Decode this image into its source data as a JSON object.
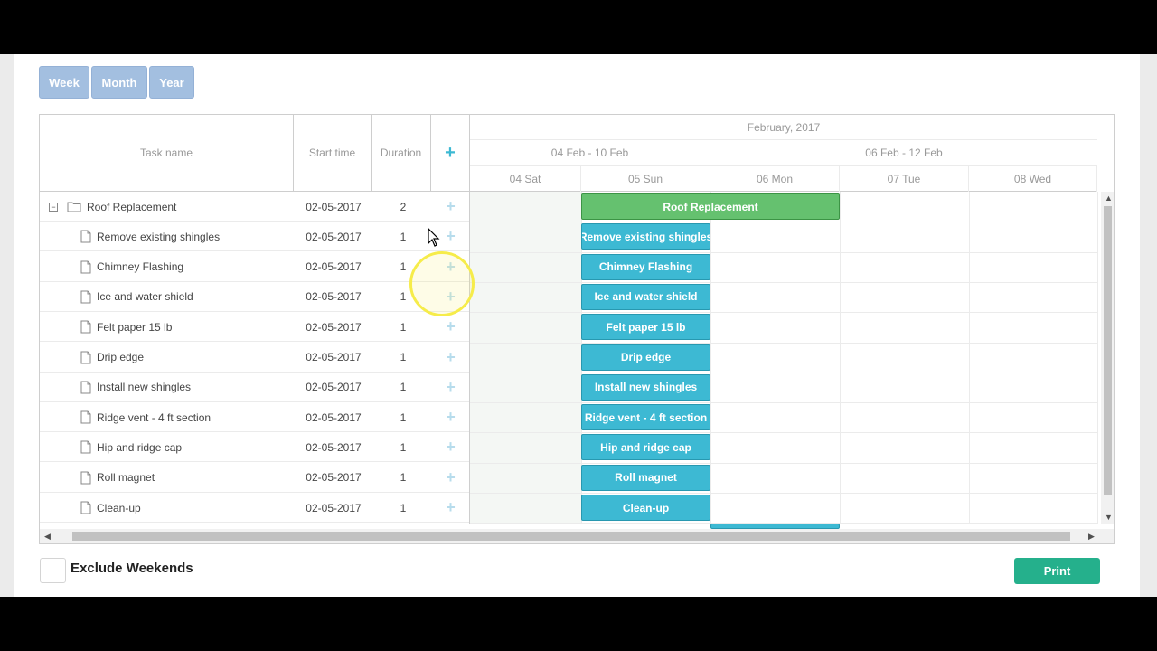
{
  "scale": {
    "week": "Week",
    "month": "Month",
    "year": "Year"
  },
  "grid_header": {
    "task_name": "Task name",
    "start_time": "Start time",
    "duration": "Duration",
    "add": "+"
  },
  "timeline": {
    "month": "February, 2017",
    "weeks": [
      "04 Feb - 10 Feb",
      "06 Feb - 12 Feb"
    ],
    "days": [
      "04 Sat",
      "05 Sun",
      "06 Mon",
      "07 Tue",
      "08 Wed"
    ]
  },
  "tasks": [
    {
      "name": "Roof Replacement",
      "start": "02-05-2017",
      "duration": "2",
      "type": "project",
      "add": "+",
      "toggle": "−"
    },
    {
      "name": "Remove existing shingles",
      "start": "02-05-2017",
      "duration": "1",
      "type": "task",
      "add": "+"
    },
    {
      "name": "Chimney Flashing",
      "start": "02-05-2017",
      "duration": "1",
      "type": "task",
      "add": "+"
    },
    {
      "name": "Ice and water shield",
      "start": "02-05-2017",
      "duration": "1",
      "type": "task",
      "add": "+"
    },
    {
      "name": "Felt paper 15 lb",
      "start": "02-05-2017",
      "duration": "1",
      "type": "task",
      "add": "+"
    },
    {
      "name": "Drip edge",
      "start": "02-05-2017",
      "duration": "1",
      "type": "task",
      "add": "+"
    },
    {
      "name": "Install new shingles",
      "start": "02-05-2017",
      "duration": "1",
      "type": "task",
      "add": "+"
    },
    {
      "name": "Ridge vent - 4 ft section",
      "start": "02-05-2017",
      "duration": "1",
      "type": "task",
      "add": "+"
    },
    {
      "name": "Hip and ridge cap",
      "start": "02-05-2017",
      "duration": "1",
      "type": "task",
      "add": "+"
    },
    {
      "name": "Roll magnet",
      "start": "02-05-2017",
      "duration": "1",
      "type": "task",
      "add": "+"
    },
    {
      "name": "Clean-up",
      "start": "02-05-2017",
      "duration": "1",
      "type": "task",
      "add": "+"
    }
  ],
  "footer": {
    "exclude_weekends": "Exclude Weekends",
    "print": "Print"
  },
  "colors": {
    "task_bar": "#3db9d3",
    "project_bar": "#65c16f",
    "print_button": "#25b08c",
    "scale_button": "#a3bfe0"
  }
}
